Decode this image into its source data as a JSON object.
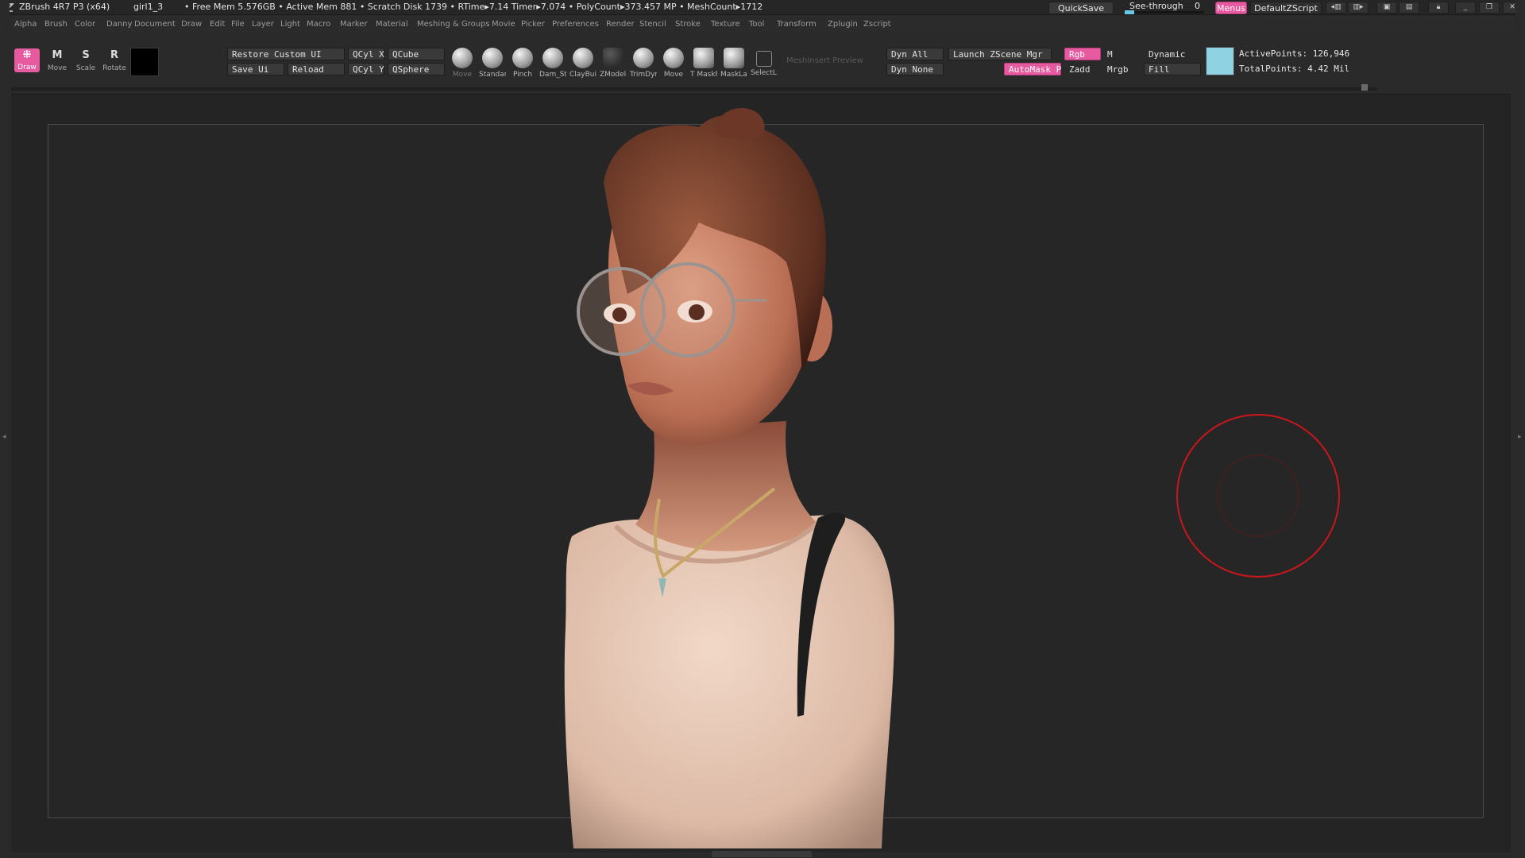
{
  "app": {
    "title": "ZBrush 4R7 P3 (x64)",
    "file": "girl1_3",
    "stats": "• Free Mem 5.576GB • Active Mem 881 • Scratch Disk 1739 •   RTime▸7.14  Timer▸7.074  • PolyCount▸373.457  MP  • MeshCount▸1712"
  },
  "titlebar": {
    "quicksave": "QuickSave",
    "seethrough": "See-through",
    "seethrough_value": "0",
    "seethrough_level": 0,
    "menus": "Menus",
    "defaultzscript": "DefaultZScript"
  },
  "menus": [
    "Alpha",
    "Brush",
    "Color",
    "Danny",
    "Document",
    "Draw",
    "Edit",
    "File",
    "Layer",
    "Light",
    "Macro",
    "Marker",
    "Material",
    "Meshing & Groups",
    "Movie",
    "Picker",
    "Preferences",
    "Render",
    "Stencil",
    "Stroke",
    "Texture",
    "Tool",
    "Transform",
    "Zplugin",
    "Zscript"
  ],
  "tools": {
    "draw": "Draw",
    "move": "Move",
    "scale": "Scale",
    "rotate": "Rotate",
    "move_glyph": "M",
    "scale_glyph": "S",
    "rotate_glyph": "R"
  },
  "shelf": {
    "restore_custom_ui": "Restore Custom UI",
    "save_ui": "Save Ui",
    "reload": "Reload",
    "qcyl_x": "QCyl X",
    "qcyl_y": "QCyl Y",
    "qcube": "QCube",
    "qsphere": "QSphere",
    "meshinsert_preview": "MeshInsert Preview",
    "dyn_all": "Dyn All",
    "dyn_none": "Dyn None",
    "launch_zscene": "Launch ZScene Mgr",
    "rgb": "Rgb",
    "m": "M",
    "automask": "AutoMask P",
    "zadd": "Zadd",
    "mrgb": "Mrgb",
    "dynamic": "Dynamic",
    "fill": "Fill",
    "active_points": "ActivePoints: 126,946",
    "total_points": "TotalPoints: 4.42 Mil"
  },
  "brushes": [
    {
      "label": "Move",
      "dim": true
    },
    {
      "label": "Standar"
    },
    {
      "label": "Pinch"
    },
    {
      "label": "Dam_St"
    },
    {
      "label": "ClayBuil"
    },
    {
      "label": "ZModele"
    },
    {
      "label": "TrimDyr"
    },
    {
      "label": "Move"
    },
    {
      "label": "T MaskPer"
    },
    {
      "label": "MaskLa:"
    },
    {
      "label": "SelectL:"
    }
  ],
  "colors": {
    "accent": "#e85aa0",
    "material": "#8fd3e3",
    "brush_cursor": "#c8161c"
  }
}
